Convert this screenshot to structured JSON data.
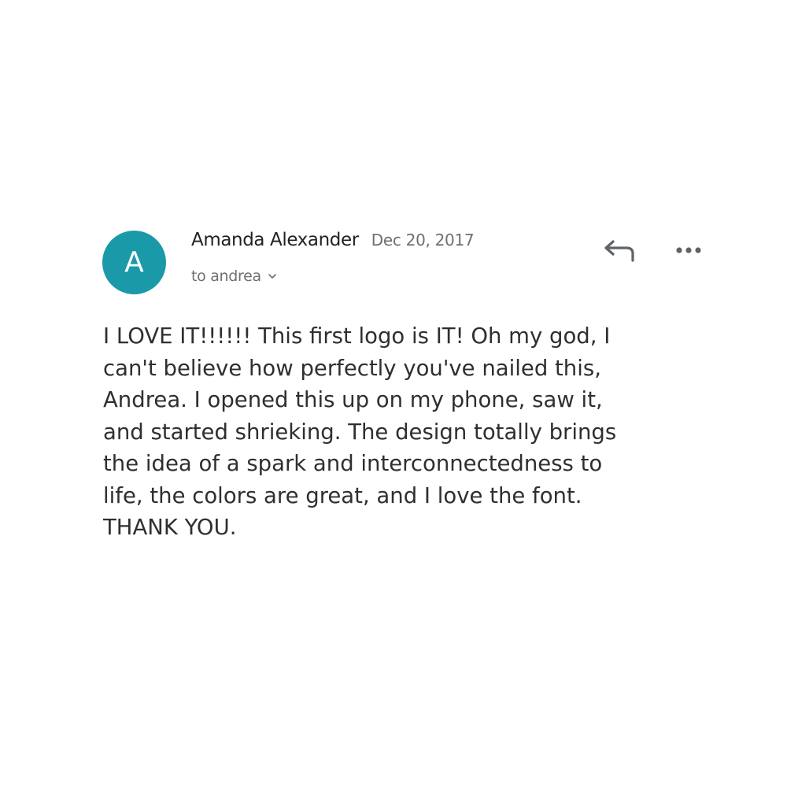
{
  "message": {
    "avatar_letter": "A",
    "avatar_color": "#1a9aa8",
    "sender_name": "Amanda Alexander",
    "date": "Dec 20, 2017",
    "recipient_label": "to andrea",
    "body_lines": [
      "I LOVE IT!!!!!! This first logo is IT! Oh my god, I",
      "can't believe how perfectly you've nailed this,",
      "Andrea. I opened this up on my phone, saw it,",
      "and started shrieking. The design totally brings",
      "the idea of a spark and interconnectedness to",
      "life, the colors are great, and I love the font.",
      "THANK YOU."
    ]
  },
  "icons": {
    "reply": "reply-icon",
    "more": "more-options-icon",
    "expand": "chevron-down-icon"
  }
}
